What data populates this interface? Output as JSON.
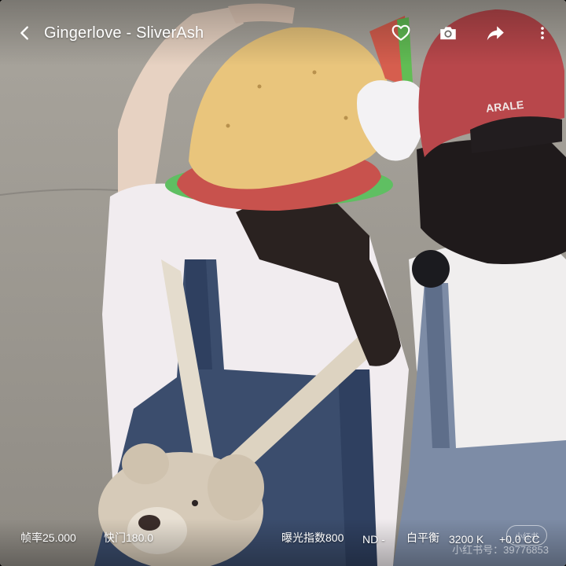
{
  "header": {
    "title": "Gingerlove - SliverAsh",
    "back_icon": "chevron-left-icon",
    "actions": [
      {
        "id": "favorite",
        "icon": "heart-outline-icon"
      },
      {
        "id": "camera",
        "icon": "camera-icon"
      },
      {
        "id": "share",
        "icon": "share-arrow-icon"
      },
      {
        "id": "more",
        "icon": "more-vertical-icon"
      }
    ]
  },
  "photo": {
    "cap_text": "ARALE"
  },
  "camera_info": {
    "frame_rate": "帧率25.000",
    "shutter": "快门180.0",
    "exposure_index": "曝光指数800",
    "nd": "ND -",
    "white_balance": "白平衡",
    "color_temp": "3200 K",
    "tint": "+0.0 CC"
  },
  "watermark": {
    "logo": "小红书",
    "text": "小红书号：39776853"
  },
  "colors": {
    "overlay_text": "#ffffff",
    "pavement": "#9b978f"
  }
}
